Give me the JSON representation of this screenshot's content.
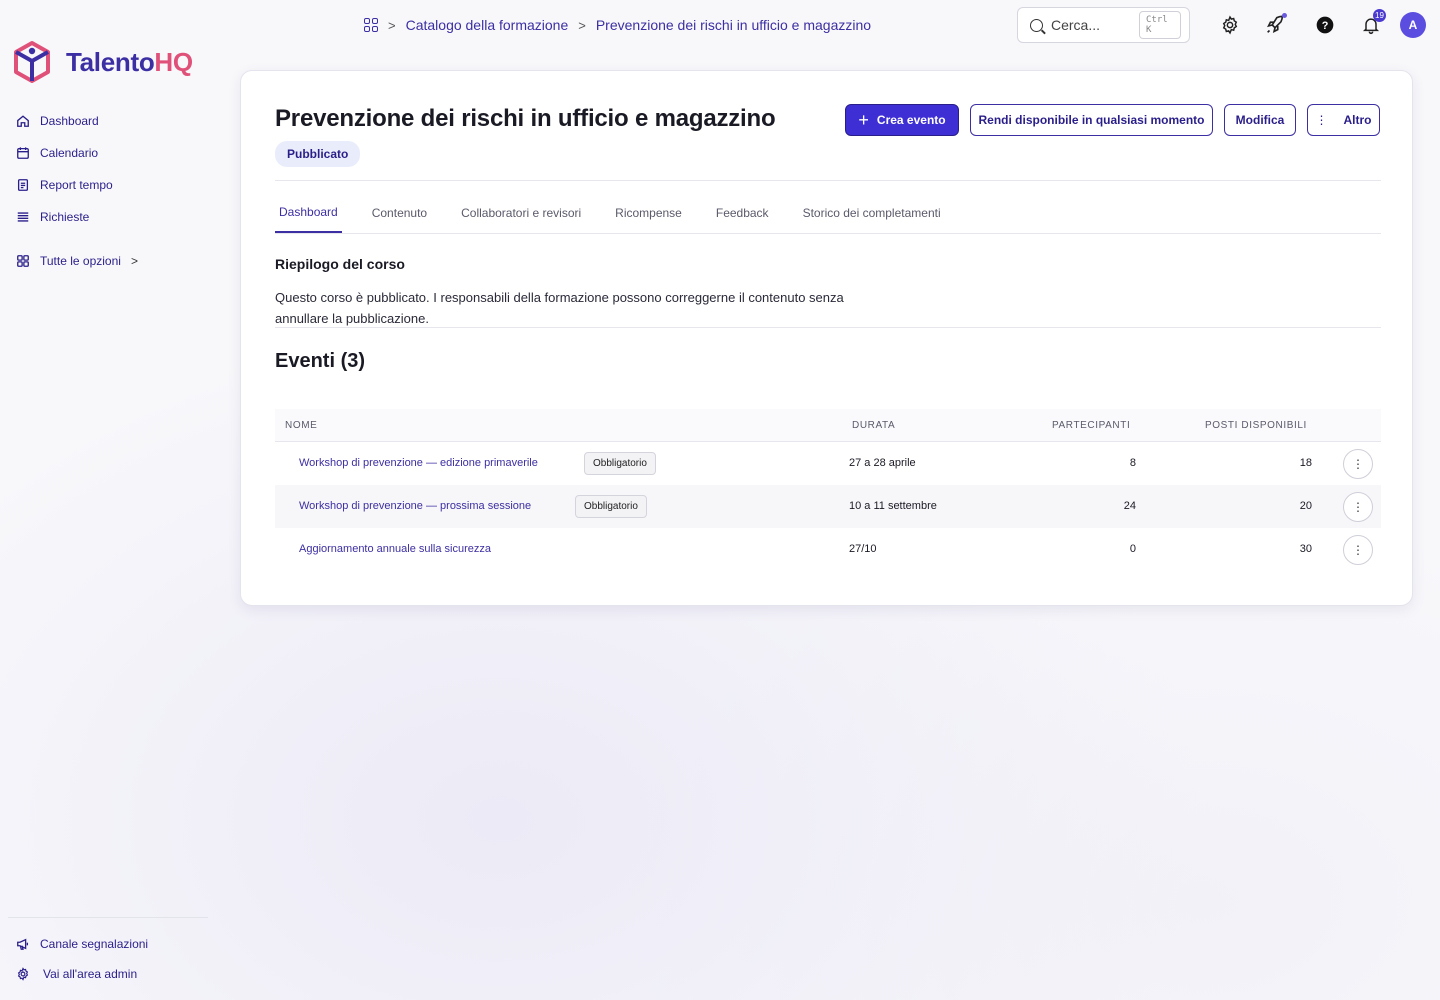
{
  "brand": {
    "name_part1": "Talento",
    "name_part2": "HQ"
  },
  "breadcrumb": {
    "root": "Catalogo della formazione",
    "current": "Prevenzione dei rischi in ufficio e magazzino"
  },
  "search": {
    "placeholder": "Cerca...",
    "shortcut": "Ctrl K"
  },
  "header": {
    "notification_count": "19",
    "avatar_initial": "A"
  },
  "sidebar": {
    "items": [
      {
        "label": "Dashboard",
        "icon": "home-icon"
      },
      {
        "label": "Calendario",
        "icon": "calendar-icon"
      },
      {
        "label": "Report tempo",
        "icon": "report-icon"
      },
      {
        "label": "Richieste",
        "icon": "list-icon"
      }
    ],
    "all_options": "Tutte le opzioni",
    "bottom": [
      {
        "label": "Canale segnalazioni",
        "icon": "megaphone-icon"
      },
      {
        "label": "Vai all'area admin",
        "icon": "gear-icon"
      }
    ]
  },
  "course": {
    "title": "Prevenzione dei rischi in ufficio e magazzino",
    "status": "Pubblicato",
    "actions": {
      "create_event": "Crea evento",
      "make_available": "Rendi disponibile in qualsiasi momento",
      "edit": "Modifica",
      "more": "Altro"
    },
    "tabs": [
      "Dashboard",
      "Contenuto",
      "Collaboratori e revisori",
      "Ricompense",
      "Feedback",
      "Storico dei completamenti"
    ],
    "summary_title": "Riepilogo del corso",
    "summary_text": "Questo corso è pubblicato. I responsabili della formazione possono correggerne il contenuto senza annullare la pubblicazione.",
    "events_title": "Eventi (3)"
  },
  "events_table": {
    "headers": {
      "name": "NOME",
      "duration": "DURATA",
      "participants": "PARTECIPANTI",
      "available": "POSTI DISPONIBILI"
    },
    "rows": [
      {
        "name": "Workshop di prevenzione — edizione primaverile",
        "tag": "Obbligatorio",
        "duration": "27 a 28 aprile",
        "participants": "8",
        "available": "18"
      },
      {
        "name": "Workshop di prevenzione — prossima sessione",
        "tag": "Obbligatorio",
        "duration": "10 a 11 settembre",
        "participants": "24",
        "available": "20"
      },
      {
        "name": "Aggiornamento annuale sulla sicurezza",
        "tag": "",
        "duration": "27/10",
        "participants": "0",
        "available": "30"
      }
    ]
  },
  "colors": {
    "accent": "#3c2fa3",
    "primary_button": "#3d2fd4",
    "brand_pink": "#e0517a"
  }
}
